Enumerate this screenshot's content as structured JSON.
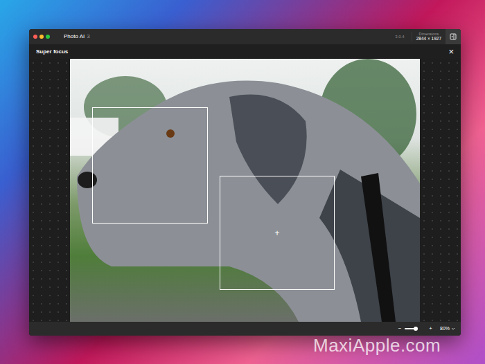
{
  "window": {
    "title": "Photo AI",
    "title_suffix": "3",
    "version": "3.0.4"
  },
  "dimensions": {
    "label": "Dimensions",
    "value": "2844 × 1927"
  },
  "panel": {
    "title": "Super focus",
    "close": "×"
  },
  "focus_boxes": [
    {
      "crosshair": false
    },
    {
      "crosshair": true
    }
  ],
  "crosshair_mark": "+",
  "zoom": {
    "minus": "−",
    "plus": "+",
    "level": 0.85,
    "reading": "80%"
  },
  "watermark": "MaxiApple.com"
}
